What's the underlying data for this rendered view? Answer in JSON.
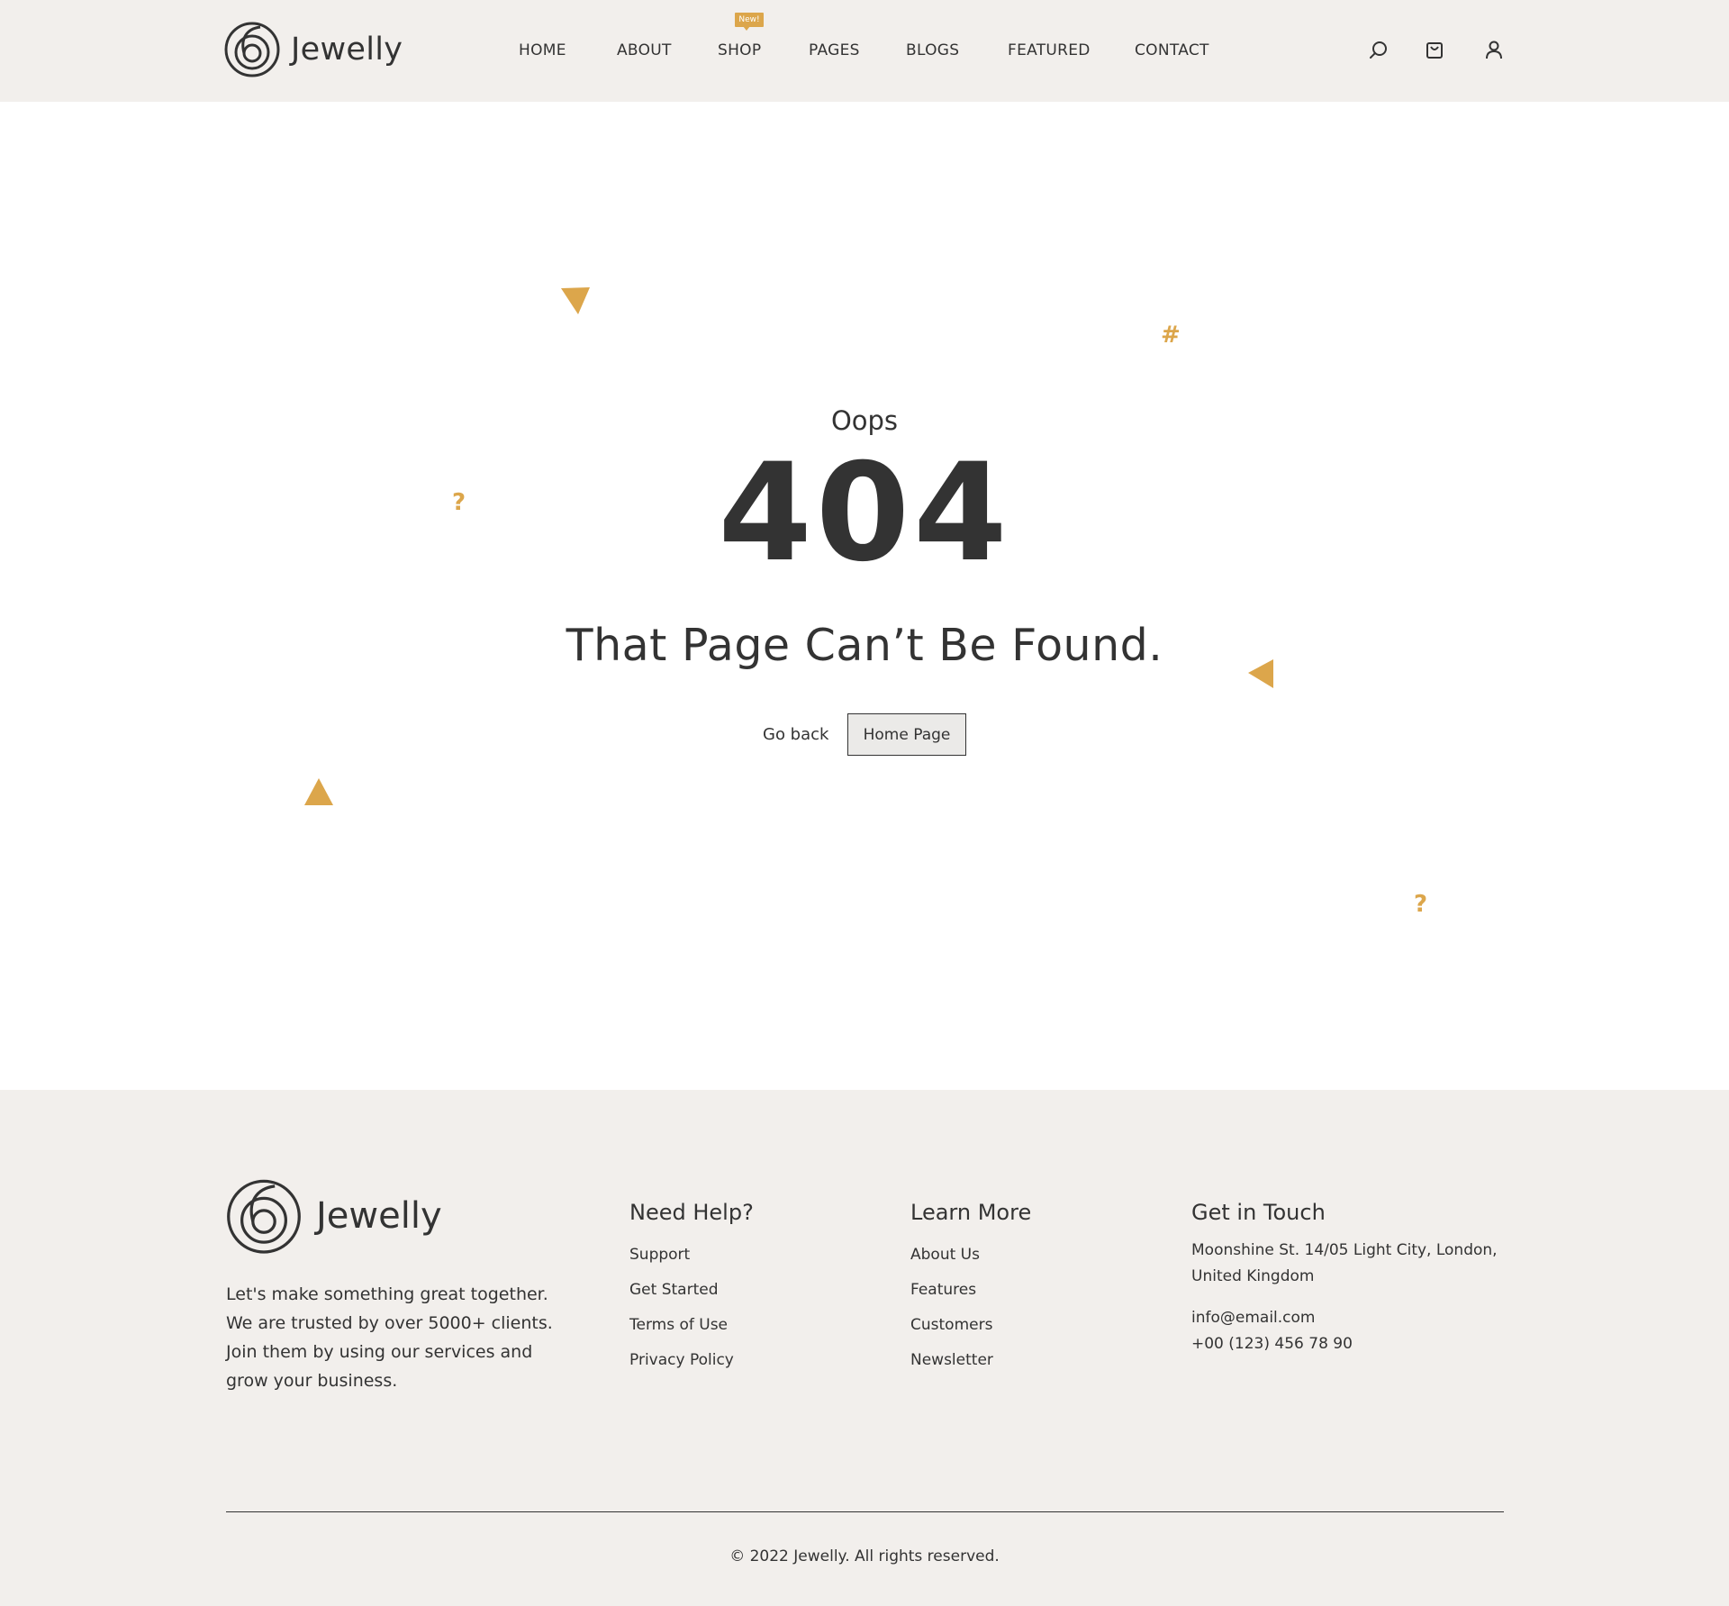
{
  "brand": {
    "name": "Jewelly",
    "accent": "#dca64b",
    "dark": "#333333",
    "header_bg": "#f2efec"
  },
  "nav": {
    "items": [
      {
        "label": "HOME"
      },
      {
        "label": "ABOUT"
      },
      {
        "label": "SHOP",
        "badge": "New!"
      },
      {
        "label": "PAGES"
      },
      {
        "label": "BLOGS"
      },
      {
        "label": "FEATURED"
      },
      {
        "label": "CONTACT"
      }
    ],
    "icons": [
      "search-icon",
      "cart-icon",
      "user-icon"
    ]
  },
  "error": {
    "eyebrow": "Oops",
    "code": "404",
    "message": "That Page Can’t Be Found.",
    "back_label": "Go back",
    "home_label": "Home Page"
  },
  "decorations": {
    "hash": "#",
    "question": "?"
  },
  "footer": {
    "about": "Let's make something great together. We are trusted by over 5000+ clients. Join them by using our services and grow your business.",
    "help": {
      "title": "Need Help?",
      "links": [
        "Support",
        "Get Started",
        "Terms of Use",
        "Privacy Policy"
      ]
    },
    "learn": {
      "title": "Learn More",
      "links": [
        "About Us",
        "Features",
        "Customers",
        "Newsletter"
      ]
    },
    "contact": {
      "title": "Get in Touch",
      "address": "Moonshine St. 14/05 Light City, London, United Kingdom",
      "email": "info@email.com",
      "phone": "+00 (123) 456 78 90"
    },
    "copyright": "© 2022 Jewelly. All rights reserved."
  }
}
